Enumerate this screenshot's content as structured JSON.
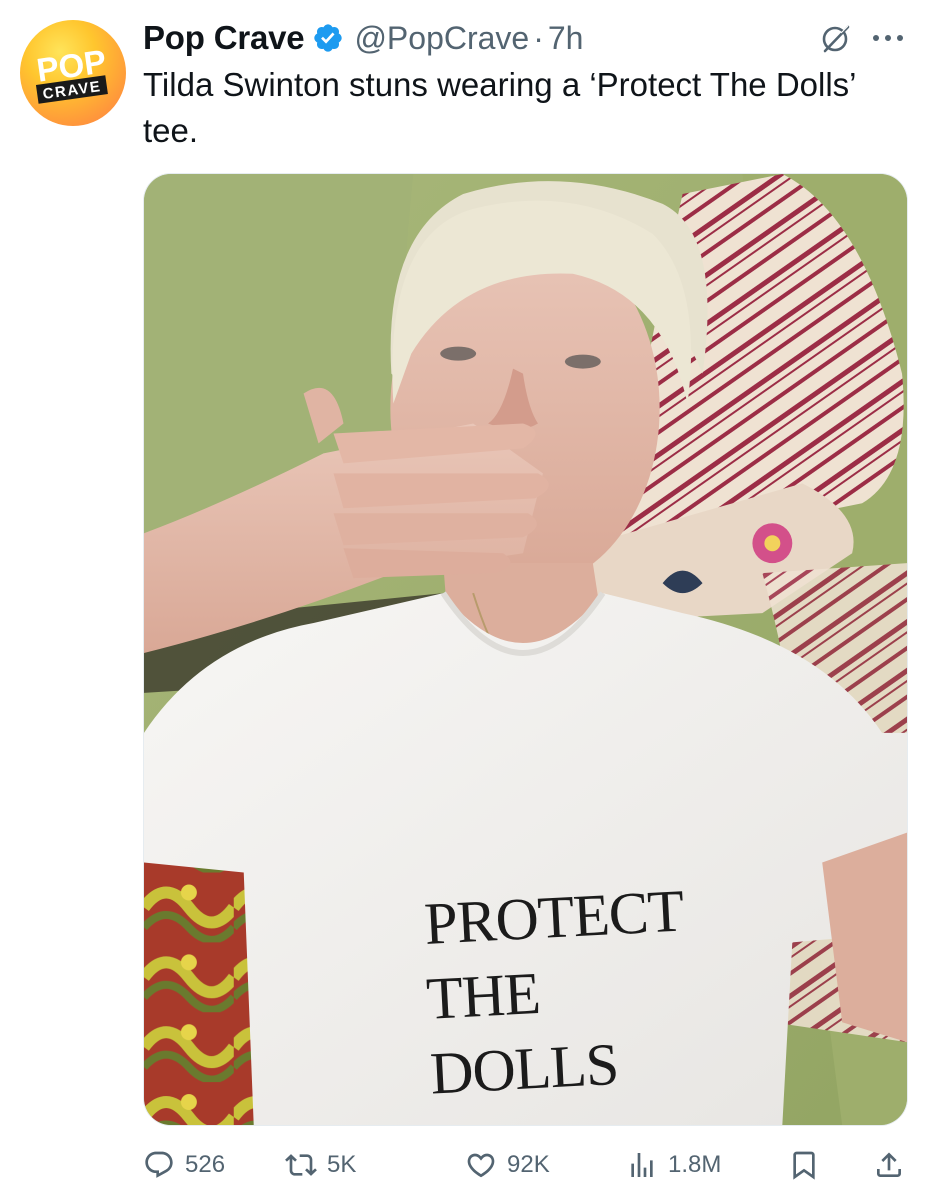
{
  "tweet": {
    "author": {
      "display_name": "Pop Crave",
      "handle": "@PopCrave",
      "verified": true,
      "avatar_text_top": "POP",
      "avatar_text_bottom": "CRAVE"
    },
    "separator": "·",
    "time": "7h",
    "text": "Tilda Swinton stuns wearing a ‘Protect The Dolls’ tee.",
    "media": {
      "type": "photo",
      "shirt_text": [
        "PROTECT",
        "THE",
        "DOLLS"
      ]
    },
    "actions": {
      "replies": "526",
      "reposts": "5K",
      "likes": "92K",
      "views": "1.8M"
    },
    "icons": {
      "verified": "verified-badge-icon",
      "grok": "grok-icon",
      "more": "more-icon",
      "reply": "reply-icon",
      "repost": "repost-icon",
      "like": "heart-icon",
      "views": "views-icon",
      "bookmark": "bookmark-icon",
      "share": "share-icon"
    },
    "colors": {
      "text_primary": "#0f1419",
      "text_secondary": "#536471",
      "verified_blue": "#1d9bf0"
    }
  }
}
